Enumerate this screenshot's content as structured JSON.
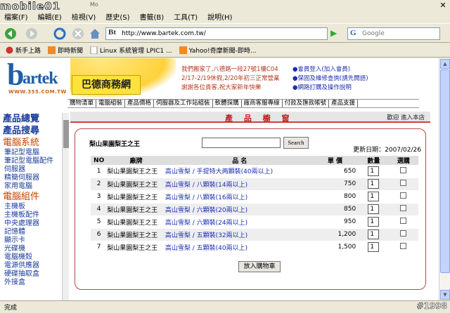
{
  "window": {
    "title_fragment": "Mo",
    "watermark": "mobile01",
    "close_glyph": "✕"
  },
  "menu": [
    "檔案(F)",
    "編輯(E)",
    "檢視(V)",
    "歷史(S)",
    "書籤(B)",
    "工具(T)",
    "說明(H)"
  ],
  "url": "http://www.bartek.com.tw/",
  "search_placeholder": "Google",
  "bookmarks": [
    "新手上路",
    "即時新聞",
    "Linux 系統管理 LPIC1 ...",
    "Yahoo!奇摩新聞-即時..."
  ],
  "header": {
    "brand_letter": "b",
    "brand_rest": "artek",
    "brand_sub": "WWW.355.COM.TW",
    "badge": "巴德商務網",
    "notice": [
      "我們搬家了,八德路一段27號1樓C04",
      "2/17-2/19休假,2/20年初三正常營業",
      "謝謝各位貴客,祝大家新年快樂"
    ],
    "links": [
      "●會員登入(加入會員)",
      "●保固及維修查詢(請先開語)",
      "●網路訂購及操作說明"
    ]
  },
  "topnav": [
    "購物清單",
    "電腦組裝",
    "產品價格",
    "伺服器及工作站組裝",
    "軟體採購",
    "廠商客服專線",
    "付款及匯款帳號",
    "產品支援"
  ],
  "sidebar": {
    "big": [
      "產品總覽",
      "產品搜尋"
    ],
    "sections": [
      {
        "title": "電腦系統",
        "items": [
          "筆記型電腦",
          "筆記型電腦配件",
          "伺服器",
          "精簡伺服器",
          "家用電腦"
        ]
      },
      {
        "title": "電腦組件",
        "items": [
          "主機板",
          "主機板配件",
          "中央處理器",
          "記憶體",
          "顯示卡",
          "光碟機",
          "電腦機殼",
          "電源供應器",
          "硬碟抽取盒",
          "外接盒"
        ]
      }
    ]
  },
  "main": {
    "title": "產 品 櫥 窗",
    "welcome": "歡迎 進入本店",
    "product_name": "梨山果園梨王之王",
    "search_btn": "Search",
    "updated": "更新日期：2007/02/26",
    "columns": [
      "NO",
      "廠牌",
      "品 名",
      "單 價",
      "數量",
      "選購"
    ],
    "rows": [
      {
        "no": "1",
        "brand": "梨山果園梨王之王",
        "name": "高山雪梨 / 手提特大两顆裝(40兩以上)",
        "price": "650",
        "qty": "1"
      },
      {
        "no": "2",
        "brand": "梨山果園梨王之王",
        "name": "高山雪梨 / 八顆裝(14兩以上)",
        "price": "750",
        "qty": "1"
      },
      {
        "no": "3",
        "brand": "梨山果園梨王之王",
        "name": "高山雪梨 / 八顆裝(16兩以上)",
        "price": "800",
        "qty": "1"
      },
      {
        "no": "4",
        "brand": "梨山果園梨王之王",
        "name": "高山雪梨 / 六顆裝(20兩以上)",
        "price": "850",
        "qty": "1"
      },
      {
        "no": "5",
        "brand": "梨山果園梨王之王",
        "name": "高山雪梨 / 六顆裝(24兩以上)",
        "price": "950",
        "qty": "1"
      },
      {
        "no": "6",
        "brand": "梨山果園梨王之王",
        "name": "高山雪梨 / 五顆裝(32兩以上)",
        "price": "1,200",
        "qty": "1"
      },
      {
        "no": "7",
        "brand": "梨山果園梨王之王",
        "name": "高山雪梨 / 五顆裝(40兩以上)",
        "price": "1,500",
        "qty": "1"
      }
    ],
    "add_btn": "放入購物車"
  },
  "status": {
    "text": "完成",
    "watermark": "#1998"
  }
}
